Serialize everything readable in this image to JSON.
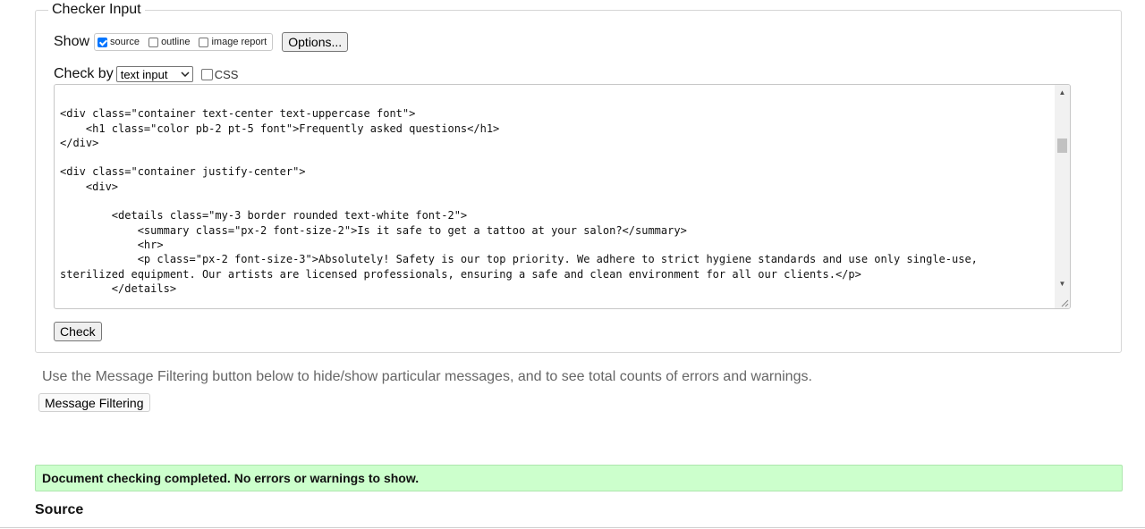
{
  "checker": {
    "legend": "Checker Input",
    "show_label": "Show",
    "show_options": [
      {
        "label": "source",
        "checked": true
      },
      {
        "label": "outline",
        "checked": false
      },
      {
        "label": "image report",
        "checked": false
      }
    ],
    "options_button": "Options...",
    "check_by_label": "Check by",
    "check_by_value": "text input",
    "css_label": "CSS",
    "css_checked": false,
    "code_lines": [
      "",
      "<div class=\"container text-center text-uppercase font\">",
      "    <h1 class=\"color pb-2 pt-5 font\">Frequently asked questions</h1>",
      "</div>",
      "",
      "<div class=\"container justify-center\">",
      "    <div>",
      "",
      "        <details class=\"my-3 border rounded text-white font-2\">",
      "            <summary class=\"px-2 font-size-2\">Is it safe to get a tattoo at your salon?</summary>",
      "            <hr>",
      "            <p class=\"px-2 font-size-3\">Absolutely! Safety is our top priority. We adhere to strict hygiene standards and use only single-use,",
      "sterilized equipment. Our artists are licensed professionals, ensuring a safe and clean environment for all our clients.</p>",
      "        </details>"
    ],
    "check_button": "Check"
  },
  "filtering": {
    "help_text": "Use the Message Filtering button below to hide/show particular messages, and to see total counts of errors and warnings.",
    "button": "Message Filtering"
  },
  "result": {
    "message": "Document checking completed. No errors or warnings to show.",
    "color": "#ccffcc"
  },
  "source_heading": "Source",
  "icons": {
    "scroll_up": "scroll-up-arrow-icon",
    "scroll_down": "scroll-down-arrow-icon",
    "select_chevron": "chevron-down-icon",
    "resize": "resize-handle-icon"
  }
}
